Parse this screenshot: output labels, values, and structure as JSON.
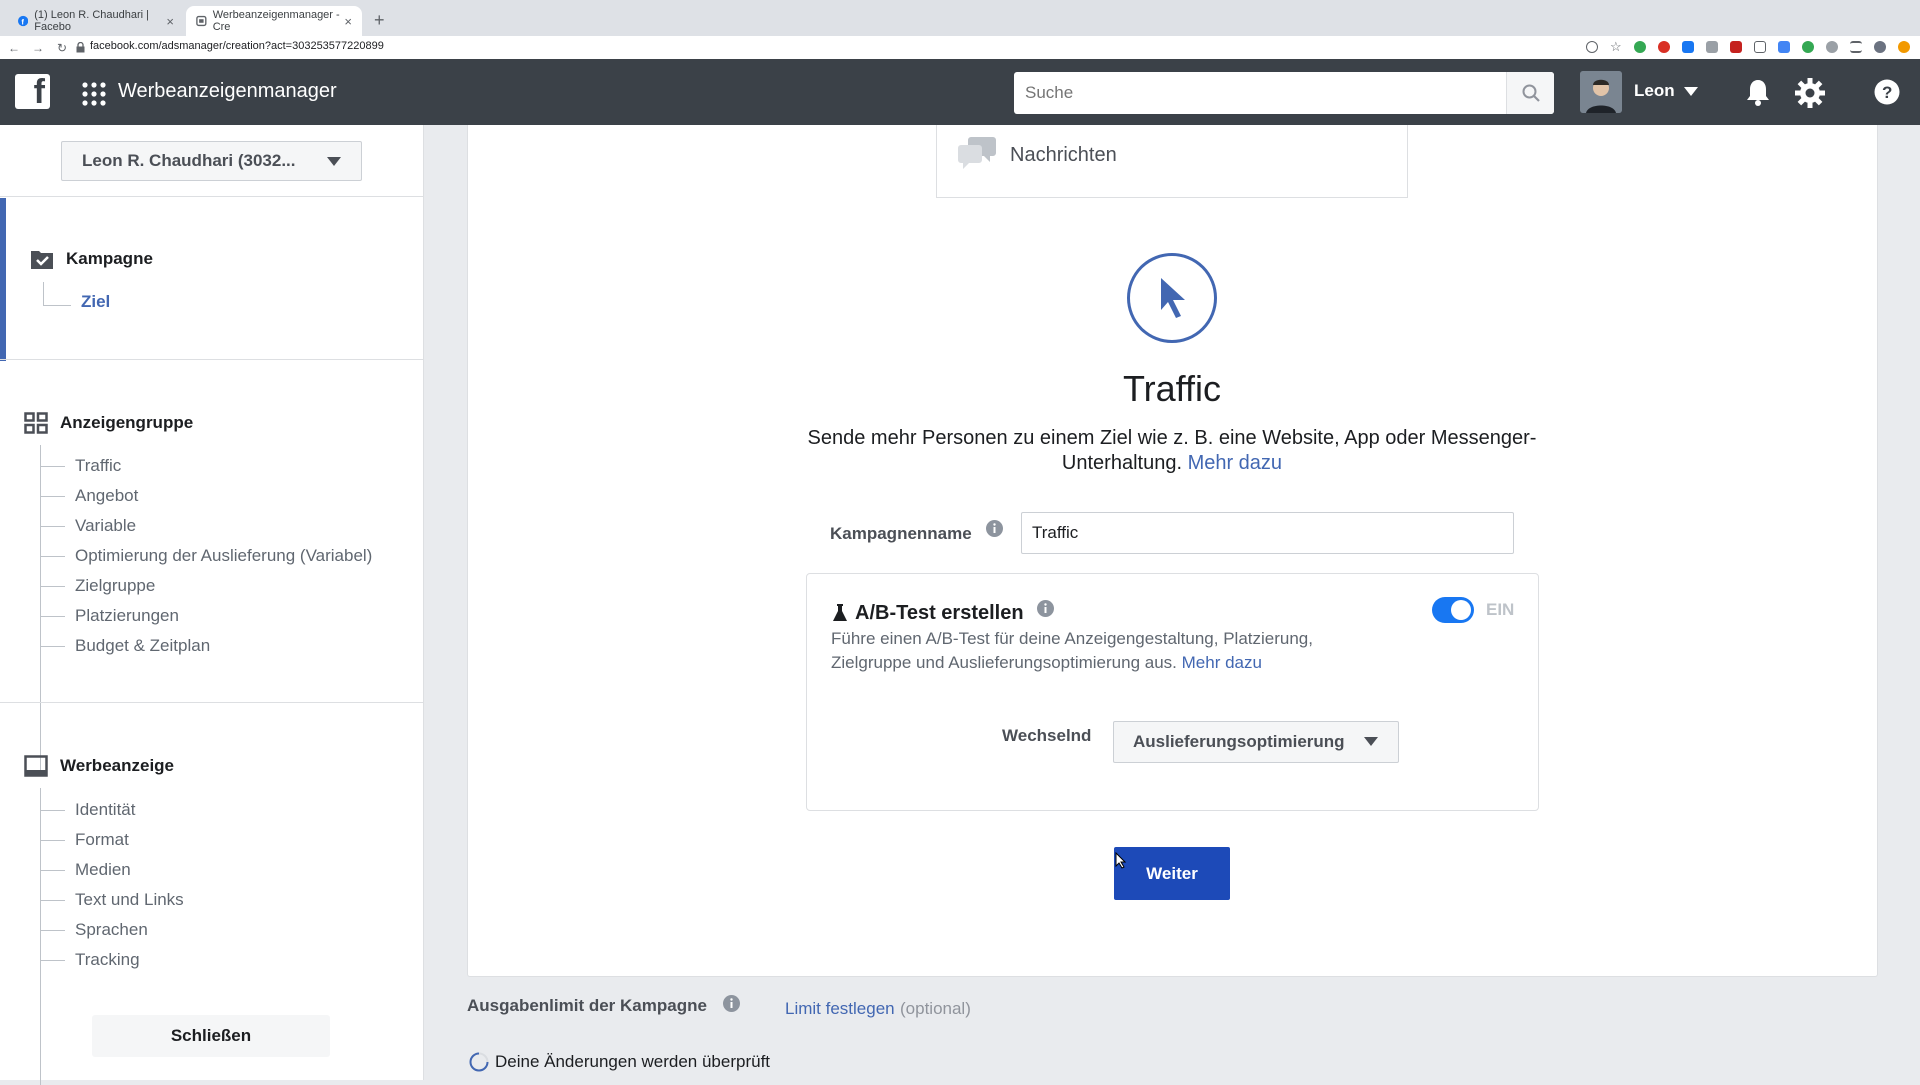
{
  "browser": {
    "tabs": [
      {
        "label": "(1) Leon R. Chaudhari | Facebo"
      },
      {
        "label": "Werbeanzeigenmanager - Cre"
      }
    ],
    "new_tab": "+",
    "url": "facebook.com/adsmanager/creation?act=303253577220899"
  },
  "header": {
    "app_title": "Werbeanzeigenmanager",
    "search_placeholder": "Suche",
    "user_name": "Leon"
  },
  "sidebar": {
    "account": "Leon R. Chaudhari (3032...",
    "campaign": {
      "title": "Kampagne",
      "items": [
        "Ziel"
      ]
    },
    "adset": {
      "title": "Anzeigengruppe",
      "items": [
        "Traffic",
        "Angebot",
        "Variable",
        "Optimierung der Auslieferung (Variabel)",
        "Zielgruppe",
        "Platzierungen",
        "Budget & Zeitplan"
      ]
    },
    "ad": {
      "title": "Werbeanzeige",
      "items": [
        "Identität",
        "Format",
        "Medien",
        "Text und Links",
        "Sprachen",
        "Tracking"
      ]
    },
    "close_label": "Schließen"
  },
  "main": {
    "objective_option": "Nachrichten",
    "objective_title": "Traffic",
    "objective_desc": "Sende mehr Personen zu einem Ziel wie z. B. eine Website, App oder Messenger-Unterhaltung.",
    "learn_more": "Mehr dazu",
    "campaign_name_label": "Kampagnenname",
    "campaign_name_value": "Traffic",
    "ab_test": {
      "title": "A/B-Test erstellen",
      "toggle_label": "EIN",
      "toggle_on": true,
      "description": "Führe einen A/B-Test für deine Anzeigengestaltung, Platzierung, Zielgruppe und Auslieferungsoptimierung aus.",
      "learn_more": "Mehr dazu",
      "variable_label": "Wechselnd",
      "variable_value": "Auslieferungsoptimierung"
    },
    "continue_label": "Weiter"
  },
  "footer": {
    "spend_limit_label": "Ausgabenlimit der Kampagne",
    "set_limit_link": "Limit festlegen",
    "optional": "(optional)",
    "review_status": "Deine Änderungen werden überprüft"
  },
  "colors": {
    "brand_blue": "#4267b2",
    "toolbar_dark": "#3b4148",
    "primary_button": "#1d4ab8",
    "toggle_on": "#1877f2"
  }
}
